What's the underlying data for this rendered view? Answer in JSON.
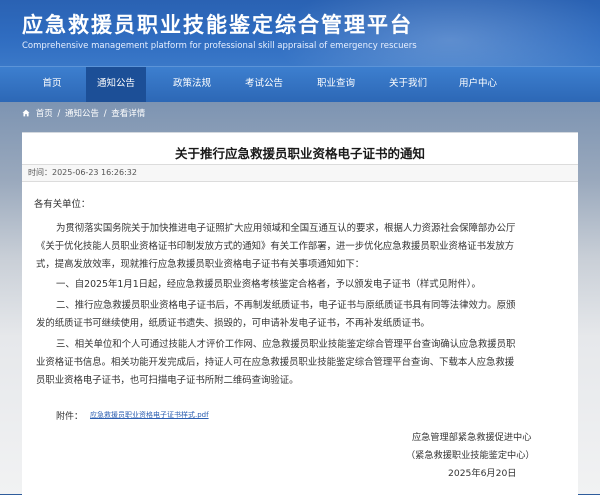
{
  "header": {
    "title": "应急救援员职业技能鉴定综合管理平台",
    "subtitle": "Comprehensive management platform for professional skill appraisal of emergency rescuers"
  },
  "nav": {
    "items": [
      {
        "label": "首页",
        "active": false
      },
      {
        "label": "通知公告",
        "active": true
      },
      {
        "label": "政策法规",
        "active": false
      },
      {
        "label": "考试公告",
        "active": false
      },
      {
        "label": "职业查询",
        "active": false
      },
      {
        "label": "关于我们",
        "active": false
      },
      {
        "label": "用户中心",
        "active": false
      }
    ]
  },
  "breadcrumb": {
    "home": "首页",
    "section": "通知公告",
    "current": "查看详情",
    "separator": "/"
  },
  "article": {
    "title": "关于推行应急救援员职业资格电子证书的通知",
    "time_label": "时间：",
    "time_value": "2025-06-23 16:26:32",
    "salutation": "各有关单位：",
    "lines": [
      "为贯彻落实国务院关于加快推进电子证照扩大应用领域和全国互通互认的要求，根据人力资源社会保障部办公厅",
      "《关于优化技能人员职业资格证书印制发放方式的通知》有关工作部署，进一步优化应急救援员职业资格证书发放方",
      "式，提高发放效率，现就推行应急救援员职业资格电子证书有关事项通知如下：",
      "一、自2025年1月1日起，经应急救援员职业资格考核鉴定合格者，予以颁发电子证书（样式见附件）。",
      "二、推行应急救援员职业资格电子证书后，不再制发纸质证书，电子证书与原纸质证书具有同等法律效力。原颁",
      "发的纸质证书可继续使用，纸质证书遗失、损毁的，可申请补发电子证书，不再补发纸质证书。",
      "三、相关单位和个人可通过技能人才评价工作网、应急救援员职业技能鉴定综合管理平台查询确认应急救援员职",
      "业资格证书信息。相关功能开发完成后，持证人可在应急救援员职业技能鉴定综合管理平台查询、下载本人应急救援",
      "员职业资格电子证书，也可扫描电子证书所附二维码查询验证。"
    ],
    "attachment_label": "附件：",
    "attachment_link": "应急救援员职业资格电子证书样式.pdf",
    "signature_org": "应急管理部紧急救援促进中心",
    "signature_sub": "（紧急救援职业技能鉴定中心）",
    "signature_date": "2025年6月20日"
  },
  "colors": {
    "header_blue": "#2f6cc0",
    "nav_active": "#1c4f97",
    "link_blue": "#2a5db0"
  }
}
